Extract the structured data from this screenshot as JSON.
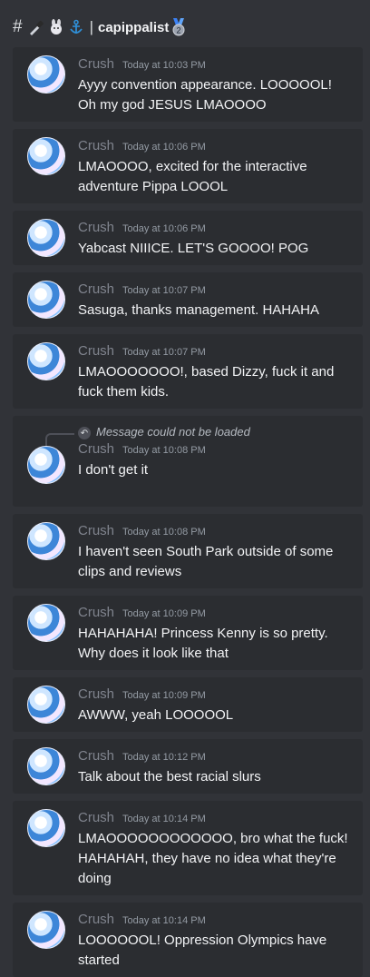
{
  "header": {
    "hash": "#",
    "emojis": [
      "knife-emoji",
      "rabbit-emoji",
      "anchor-emoji"
    ],
    "pipe": "|",
    "channel": "capippalist",
    "badge": "2"
  },
  "messages": [
    {
      "author": "Crush",
      "time": "Today at 10:03 PM",
      "text": "Ayyy convention appearance. LOOOOOL! Oh my god JESUS LMAOOOO"
    },
    {
      "author": "Crush",
      "time": "Today at 10:06 PM",
      "text": "LMAOOOO, excited for the interactive adventure Pippa LOOOL"
    },
    {
      "author": "Crush",
      "time": "Today at 10:06 PM",
      "text": "Yabcast NIIICE. LET'S GOOOO! POG"
    },
    {
      "author": "Crush",
      "time": "Today at 10:07 PM",
      "text": "Sasuga, thanks management. HAHAHA"
    },
    {
      "author": "Crush",
      "time": "Today at 10:07 PM",
      "text": "LMAOOOOOOO!, based Dizzy, fuck it and fuck them kids."
    },
    {
      "author": "Crush",
      "time": "Today at 10:08 PM",
      "text": "I don't get it",
      "reply": "Message could not be loaded"
    },
    {
      "author": "Crush",
      "time": "Today at 10:08 PM",
      "text": "I haven't seen South Park outside of some clips and reviews"
    },
    {
      "author": "Crush",
      "time": "Today at 10:09 PM",
      "text": "HAHAHAHA! Princess Kenny is so pretty. Why does it look like that"
    },
    {
      "author": "Crush",
      "time": "Today at 10:09 PM",
      "text": "AWWW, yeah LOOOOOL"
    },
    {
      "author": "Crush",
      "time": "Today at 10:12 PM",
      "text": "Talk about the best racial slurs"
    },
    {
      "author": "Crush",
      "time": "Today at 10:14 PM",
      "text": "LMAOOOOOOOOOOOO, bro what the fuck! HAHAHAH, they have no idea what they're doing"
    },
    {
      "author": "Crush",
      "time": "Today at 10:14 PM",
      "text": "LOOOOOOL! Oppression Olympics have started"
    }
  ]
}
